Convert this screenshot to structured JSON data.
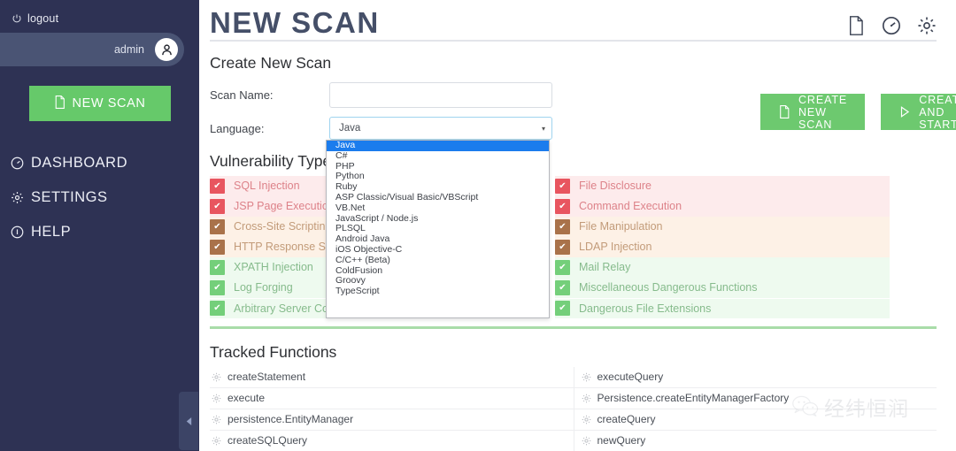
{
  "sidebar": {
    "logout_label": "logout",
    "user_name": "admin",
    "new_scan_label": "NEW SCAN",
    "nav_items": [
      {
        "label": "DASHBOARD",
        "icon": "gauge-icon"
      },
      {
        "label": "SETTINGS",
        "icon": "gear-icon"
      },
      {
        "label": "HELP",
        "icon": "info-icon"
      }
    ],
    "collapse_glyph": "◀"
  },
  "header": {
    "title": "NEW SCAN",
    "icons": [
      "file-icon",
      "gauge-icon",
      "gear-icon"
    ]
  },
  "form": {
    "section_title": "Create New Scan",
    "scan_name_label": "Scan Name:",
    "scan_name_value": "",
    "scan_name_placeholder": "",
    "language_label": "Language:",
    "language_value": "Java",
    "caret_glyph": "▾",
    "language_options": [
      "Java",
      "C#",
      "PHP",
      "Python",
      "Ruby",
      "ASP Classic/Visual Basic/VBScript",
      "VB.Net",
      "JavaScript / Node.js",
      "PLSQL",
      "Android Java",
      "iOS Objective-C",
      "C/C++ (Beta)",
      "ColdFusion",
      "Groovy",
      "TypeScript"
    ],
    "selected_option_index": 0
  },
  "actions": {
    "create_new_scan": "CREATE NEW SCAN",
    "create_and_start": "CREATE AND START"
  },
  "vulnerability_types": {
    "heading": "Vulnerability Types",
    "check_glyph": "✔",
    "severity_colors": {
      "red": {
        "box": "#e8555f",
        "bg": "#fdebec",
        "text": "#dd8289"
      },
      "brown": {
        "box": "#a9724a",
        "bg": "#fdf1e6",
        "text": "#c29b79"
      },
      "green": {
        "box": "#74cf7a",
        "bg": "#eefaef",
        "text": "#86bb8c"
      }
    },
    "left_column": [
      {
        "label": "SQL Injection",
        "severity": "red",
        "checked": true
      },
      {
        "label": "JSP Page Execution",
        "severity": "red",
        "checked": true
      },
      {
        "label": "Cross-Site Scripting",
        "severity": "brown",
        "checked": true
      },
      {
        "label": "HTTP Response Splitting",
        "severity": "brown",
        "checked": true
      },
      {
        "label": "XPATH Injection",
        "severity": "green",
        "checked": true
      },
      {
        "label": "Log Forging",
        "severity": "green",
        "checked": true
      },
      {
        "label": "Arbitrary Server Connection",
        "severity": "green",
        "checked": true
      }
    ],
    "right_column": [
      {
        "label": "File Disclosure",
        "severity": "red",
        "checked": true
      },
      {
        "label": "Command Execution",
        "severity": "red",
        "checked": true
      },
      {
        "label": "File Manipulation",
        "severity": "brown",
        "checked": true
      },
      {
        "label": "LDAP Injection",
        "severity": "brown",
        "checked": true
      },
      {
        "label": "Mail Relay",
        "severity": "green",
        "checked": true
      },
      {
        "label": "Miscellaneous Dangerous Functions",
        "severity": "green",
        "checked": true
      },
      {
        "label": "Dangerous File Extensions",
        "severity": "green",
        "checked": true
      }
    ]
  },
  "tracked_functions": {
    "heading": "Tracked Functions",
    "left_column": [
      "createStatement",
      "execute",
      "persistence.EntityManager",
      "createSQLQuery"
    ],
    "right_column": [
      "executeQuery",
      "Persistence.createEntityManagerFactory",
      "createQuery",
      "newQuery"
    ]
  },
  "watermark": {
    "text": "经纬恒润"
  }
}
